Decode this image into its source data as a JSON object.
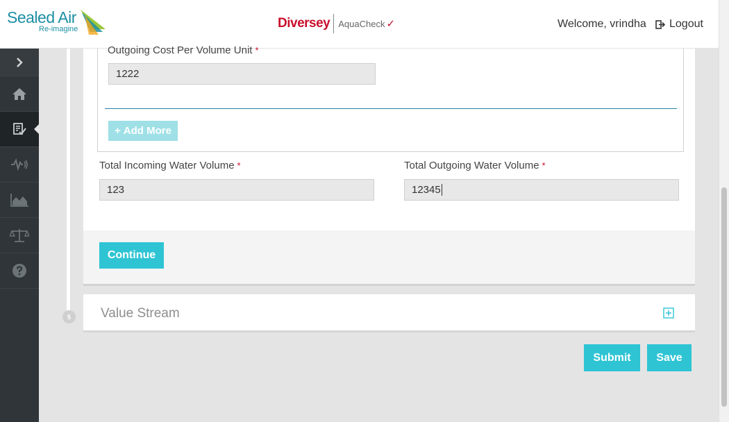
{
  "header": {
    "brand_left_name": "Sealed Air",
    "brand_left_tagline": "Re-imagine",
    "brand_center_name": "Diversey",
    "brand_center_product": "AquaCheck",
    "welcome_text": "Welcome, vrindha",
    "logout_label": "Logout"
  },
  "sidebar": {
    "items": [
      {
        "icon": "chevron-right-icon"
      },
      {
        "icon": "home-icon"
      },
      {
        "icon": "checklist-icon",
        "active": true
      },
      {
        "icon": "signal-wave-icon"
      },
      {
        "icon": "area-chart-icon"
      },
      {
        "icon": "balance-scale-icon"
      },
      {
        "icon": "help-icon"
      }
    ]
  },
  "form": {
    "outgoing_cost_label": "Outgoing Cost Per Volume Unit",
    "outgoing_cost_value": "1222",
    "add_more_label": "Add More",
    "total_incoming_label": "Total Incoming Water Volume",
    "total_incoming_value": "123",
    "total_outgoing_label": "Total Outgoing Water Volume",
    "total_outgoing_value": "12345",
    "required_mark": "*",
    "continue_label": "Continue"
  },
  "steps": {
    "value_stream_number": "5",
    "value_stream_title": "Value Stream"
  },
  "actions": {
    "submit_label": "Submit",
    "save_label": "Save"
  },
  "colors": {
    "accent": "#2ec4d4",
    "sidebar_bg": "#2f3539",
    "required": "#c8102e",
    "brand_teal": "#1d8fa3"
  }
}
